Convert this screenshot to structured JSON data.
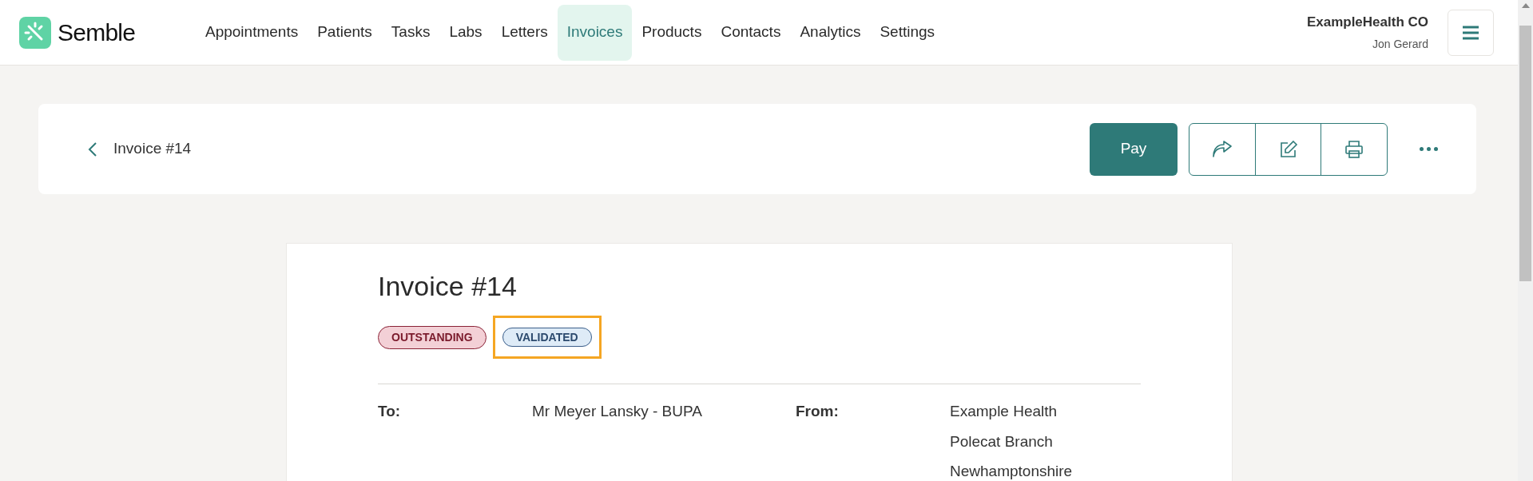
{
  "brand": {
    "name": "Semble"
  },
  "nav": [
    {
      "label": "Appointments",
      "selected": false
    },
    {
      "label": "Patients",
      "selected": false
    },
    {
      "label": "Tasks",
      "selected": false
    },
    {
      "label": "Labs",
      "selected": false
    },
    {
      "label": "Letters",
      "selected": false
    },
    {
      "label": "Invoices",
      "selected": true
    },
    {
      "label": "Products",
      "selected": false
    },
    {
      "label": "Contacts",
      "selected": false
    },
    {
      "label": "Analytics",
      "selected": false
    },
    {
      "label": "Settings",
      "selected": false
    }
  ],
  "account": {
    "organisation": "ExampleHealth CO",
    "user": "Jon Gerard"
  },
  "header": {
    "title": "Invoice #14",
    "pay_button": "Pay"
  },
  "invoice": {
    "title": "Invoice #14",
    "badges": [
      {
        "label": "OUTSTANDING",
        "color": "#f3d0d6",
        "highlighted": false
      },
      {
        "label": "VALIDATED",
        "color": "#deebf7",
        "highlighted": true
      }
    ],
    "to": {
      "label": "To:",
      "lines": [
        "Mr Meyer Lansky - BUPA"
      ]
    },
    "from": {
      "label": "From:",
      "lines": [
        "Example Health",
        "Polecat Branch",
        "Newhamptonshire"
      ]
    }
  }
}
